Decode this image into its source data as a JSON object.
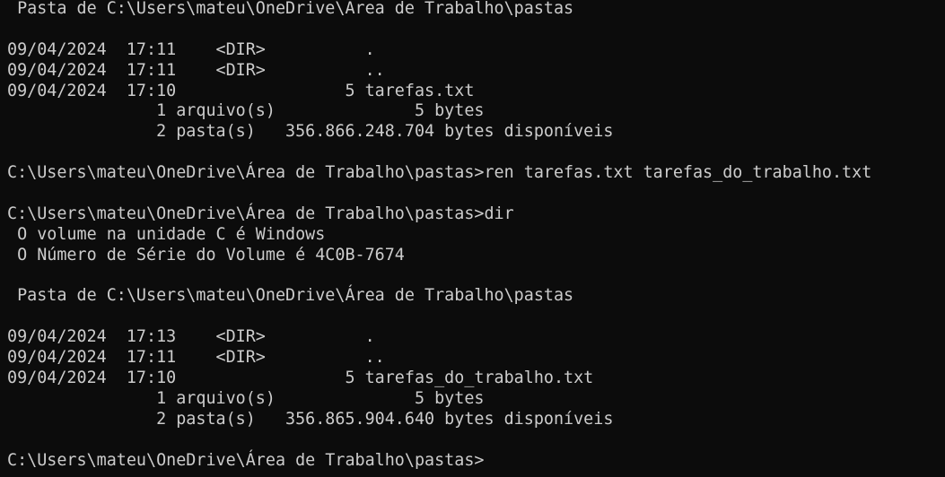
{
  "terminal": {
    "lines": [
      " Pasta de C:\\Users\\mateu\\OneDrive\\Área de Trabalho\\pastas",
      "",
      "09/04/2024  17:11    <DIR>          .",
      "09/04/2024  17:11    <DIR>          ..",
      "09/04/2024  17:10                 5 tarefas.txt",
      "               1 arquivo(s)              5 bytes",
      "               2 pasta(s)   356.866.248.704 bytes disponíveis",
      "",
      "C:\\Users\\mateu\\OneDrive\\Área de Trabalho\\pastas>ren tarefas.txt tarefas_do_trabalho.txt",
      "",
      "C:\\Users\\mateu\\OneDrive\\Área de Trabalho\\pastas>dir",
      " O volume na unidade C é Windows",
      " O Número de Série do Volume é 4C0B-7674",
      "",
      " Pasta de C:\\Users\\mateu\\OneDrive\\Área de Trabalho\\pastas",
      "",
      "09/04/2024  17:13    <DIR>          .",
      "09/04/2024  17:11    <DIR>          ..",
      "09/04/2024  17:10                 5 tarefas_do_trabalho.txt",
      "               1 arquivo(s)              5 bytes",
      "               2 pasta(s)   356.865.904.640 bytes disponíveis",
      "",
      "C:\\Users\\mateu\\OneDrive\\Área de Trabalho\\pastas>"
    ]
  },
  "colors": {
    "background": "#0c0c0c",
    "foreground": "#cccccc"
  }
}
